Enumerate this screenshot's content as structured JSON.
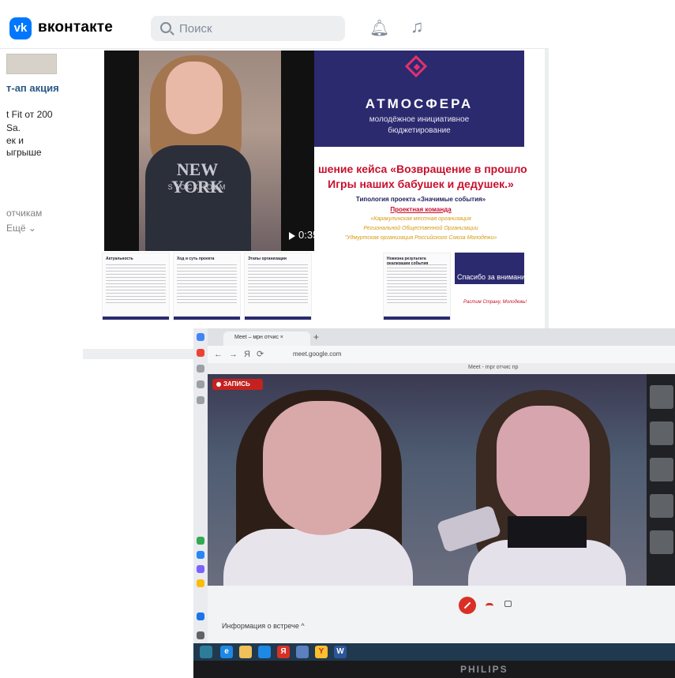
{
  "vk": {
    "logo_letters": "vk",
    "brand": "вконтакте",
    "search_placeholder": "Поиск",
    "bell_icon": "bell-icon",
    "music_icon": "music-icon",
    "sidebar": {
      "ad_title": "т-ап акция",
      "ad_lines": [
        "t Fit от 200",
        "Sa.",
        "ек и",
        "ыгрыше"
      ],
      "subscribers": "отчикам",
      "more": "Ещё ⌄"
    },
    "post": {
      "video_duration": "0:35",
      "shirt_text_1": "NEW YORK",
      "shirt_text_2": "STOCKHOLM",
      "slide_brand": "АТМОСФЕРА",
      "slide_sub1": "молодёжное инициативное",
      "slide_sub2": "бюджетирование",
      "case_line1": "шение кейса «Возвращение в прошло",
      "case_line2": "Игры наших бабушек и дедушек.»",
      "typology": "Типология проекта «Значимые события»",
      "team": "Проектная команда",
      "orgs": [
        "«Каракулинская местная организация",
        "Региональной Общественной Организации",
        "\"Удмуртская организация Российского Союза Молодежи»"
      ],
      "thumbs": [
        "Актуальность",
        "Ход и суть проекта",
        "Этапы организации",
        "Новизна результата реализации события"
      ],
      "thanks": "Спасибо за внимание",
      "thanks_sub": "Растим Страну, Молодежь!"
    }
  },
  "meet": {
    "tab_title": "Meet – мрн отчис ×",
    "url": "meet.google.com",
    "window_title": "Meet - mpr отчис пр",
    "record_label": "ЗАПИСЬ",
    "info_label": "Информация о встрече ^",
    "monitor_brand": "PHILIPS"
  }
}
